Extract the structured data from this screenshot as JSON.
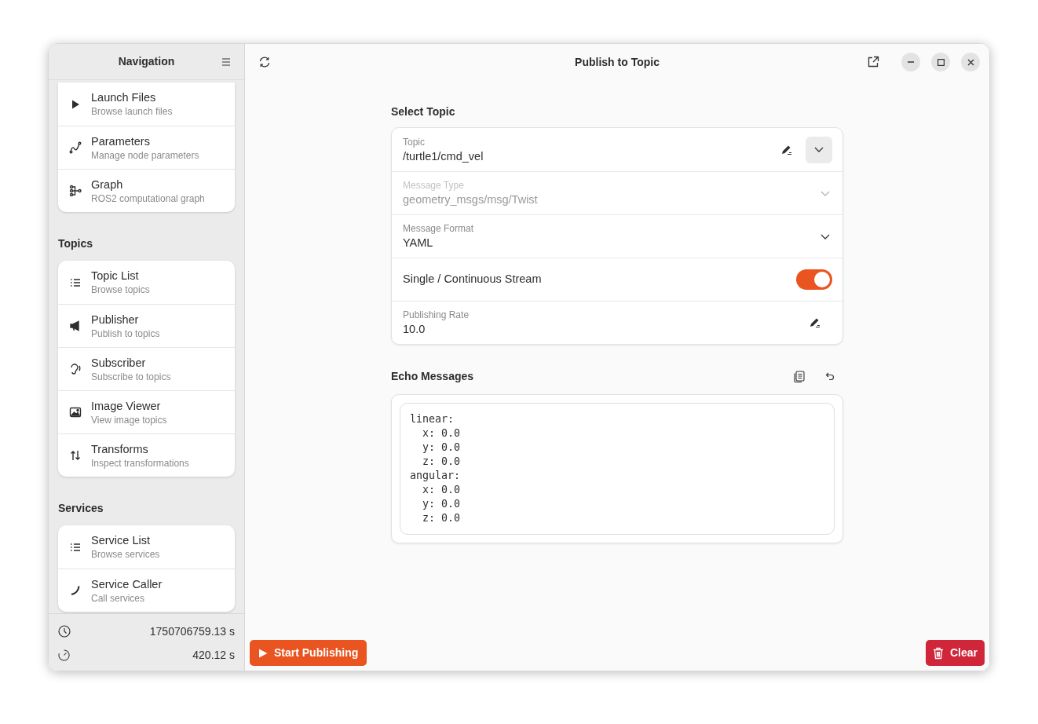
{
  "window": {
    "title": "Publish to Topic"
  },
  "sidebar": {
    "title": "Navigation",
    "sections": [
      {
        "items": [
          {
            "title": "Launch Files",
            "subtitle": "Browse launch files"
          },
          {
            "title": "Parameters",
            "subtitle": "Manage node parameters"
          },
          {
            "title": "Graph",
            "subtitle": "ROS2 computational graph"
          }
        ]
      },
      {
        "heading": "Topics",
        "items": [
          {
            "title": "Topic List",
            "subtitle": "Browse topics"
          },
          {
            "title": "Publisher",
            "subtitle": "Publish to topics"
          },
          {
            "title": "Subscriber",
            "subtitle": "Subscribe to topics"
          },
          {
            "title": "Image Viewer",
            "subtitle": "View image topics"
          },
          {
            "title": "Transforms",
            "subtitle": "Inspect transformations"
          }
        ]
      },
      {
        "heading": "Services",
        "items": [
          {
            "title": "Service List",
            "subtitle": "Browse services"
          },
          {
            "title": "Service Caller",
            "subtitle": "Call services"
          }
        ]
      }
    ],
    "footer": [
      {
        "value": "1750706759.13 s"
      },
      {
        "value": "420.12 s"
      }
    ]
  },
  "select_topic": {
    "heading": "Select Topic",
    "fields": [
      {
        "kind": "combo",
        "label": "Topic",
        "value": "/turtle1/cmd_vel",
        "disabled": false
      },
      {
        "kind": "select",
        "label": "Message Type",
        "value": "geometry_msgs/msg/Twist",
        "disabled": true
      },
      {
        "kind": "select",
        "label": "Message Format",
        "value": "YAML",
        "disabled": false
      },
      {
        "kind": "switch",
        "label": "Single / Continuous Stream",
        "on": true,
        "disabled": false
      },
      {
        "kind": "entry",
        "label": "Publishing Rate",
        "value": "10.0",
        "disabled": false
      }
    ]
  },
  "echo": {
    "heading": "Echo Messages",
    "text": "linear:\n  x: 0.0\n  y: 0.0\n  z: 0.0\nangular:\n  x: 0.0\n  y: 0.0\n  z: 0.0"
  },
  "buttons": {
    "start": "Start Publishing",
    "clear": "Clear"
  }
}
